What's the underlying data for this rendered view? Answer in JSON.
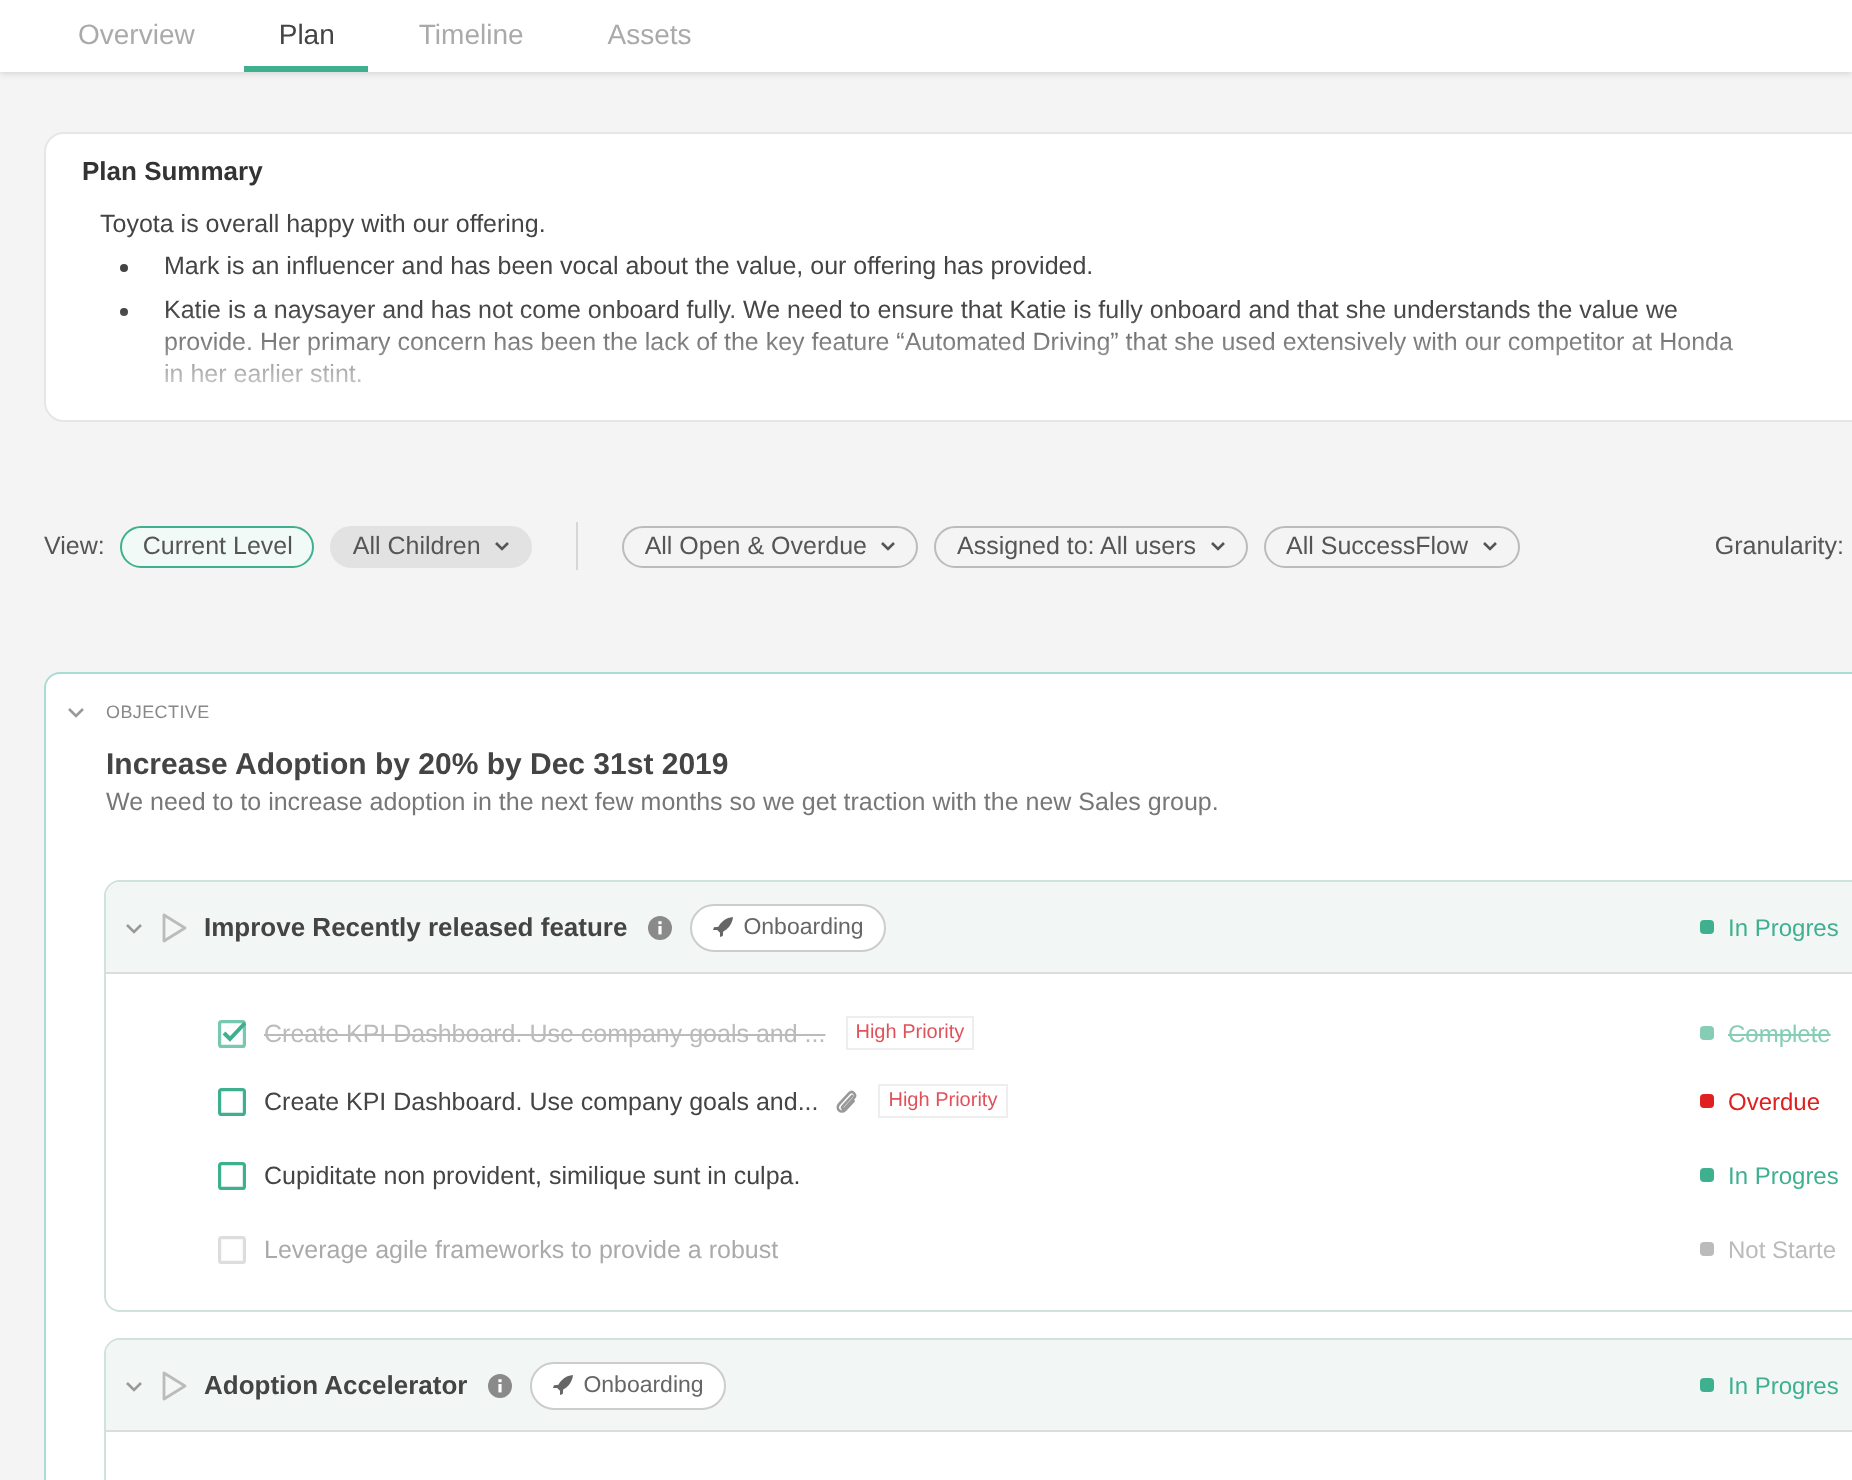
{
  "tabs": [
    {
      "label": "Overview",
      "selected": false
    },
    {
      "label": "Plan",
      "selected": true
    },
    {
      "label": "Timeline",
      "selected": false
    },
    {
      "label": "Assets",
      "selected": false
    }
  ],
  "plan_summary": {
    "title": "Plan Summary",
    "intro": "Toyota is overall happy with our offering.",
    "bullets": [
      "Mark is an influencer and has been vocal about the value, our offering has provided.",
      "Katie is a naysayer and has not come onboard fully. We need to ensure that Katie is fully onboard and that she understands the value we provide. Her primary concern has been the lack of the key feature “Automated Driving” that she used extensively with our competitor at Honda in her earlier stint."
    ]
  },
  "filters": {
    "view_label": "View:",
    "view_options": [
      {
        "label": "Current Level",
        "selected": true,
        "dropdown": false
      },
      {
        "label": "All Children",
        "selected": false,
        "dropdown": true
      }
    ],
    "dropdowns": [
      "All Open & Overdue",
      "Assigned to: All users",
      "All SuccessFlow"
    ],
    "granularity_label": "Granularity:"
  },
  "objective": {
    "label": "OBJECTIVE",
    "expanded": true,
    "title": "Increase Adoption by 20% by Dec 31st 2019",
    "description": "We need to to increase adoption in the next few months so we get traction with the new Sales group.",
    "goals": [
      {
        "name": "Improve Recently released feature",
        "expanded": true,
        "tag": "Onboarding",
        "status": "In Progres",
        "color": "#3fb08f",
        "tasks": [
          {
            "text": "Create KPI Dashboard. Use company goals and ...",
            "checked": true,
            "disabled": false,
            "attachment": false,
            "priority": "High Priority",
            "status": "Complete",
            "color": "#85cdb5"
          },
          {
            "text": "Create KPI Dashboard. Use company goals and...",
            "checked": false,
            "disabled": false,
            "attachment": true,
            "priority": "High Priority",
            "status": "Overdue",
            "color": "#e02020"
          },
          {
            "text": "Cupiditate non provident, similique sunt in culpa.",
            "checked": false,
            "disabled": false,
            "attachment": false,
            "status": "In Progres",
            "color": "#3fb08f"
          },
          {
            "text": "Leverage agile frameworks to provide a robust",
            "checked": false,
            "disabled": true,
            "attachment": false,
            "status": "Not Starte",
            "color": "#bbbbbb"
          }
        ]
      },
      {
        "name": "Adoption Accelerator",
        "expanded": true,
        "tag": "Onboarding",
        "status": "In Progres",
        "color": "#3fb08f"
      }
    ]
  }
}
